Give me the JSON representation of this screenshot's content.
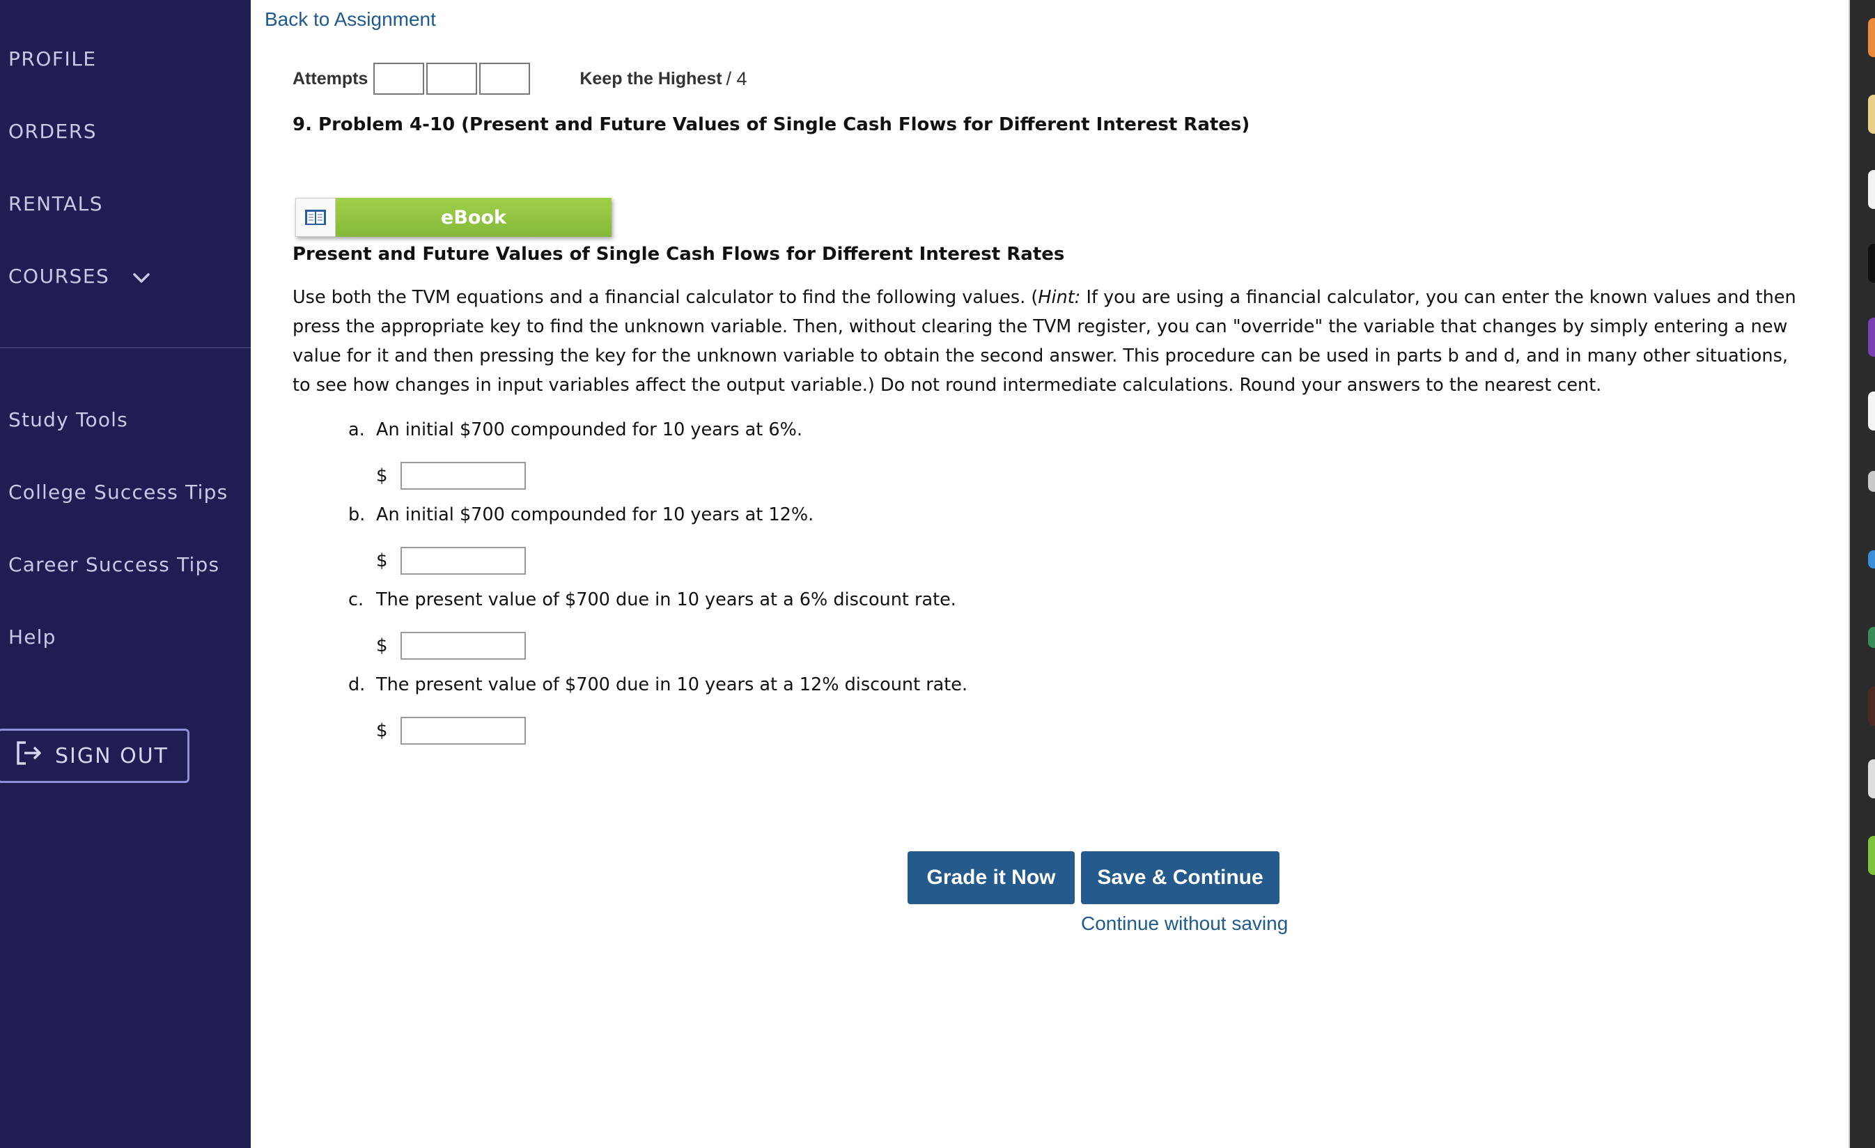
{
  "sidebar": {
    "nav": [
      "PROFILE",
      "ORDERS",
      "RENTALS",
      "COURSES"
    ],
    "tools": [
      "Study Tools",
      "College Success Tips",
      "Career Success Tips",
      "Help"
    ],
    "sign_out": "SIGN OUT"
  },
  "header": {
    "back_link": "Back to Assignment",
    "attempts_label": "Attempts",
    "keep_label": "Keep the Highest",
    "keep_score": "/ 4"
  },
  "problem": {
    "title": "9.  Problem 4-10 (Present and Future Values of Single Cash Flows for Different Interest Rates)",
    "ebook_label": "eBook",
    "subtitle": "Present and Future Values of Single Cash Flows for Different Interest Rates",
    "instructions_pre": "Use both the TVM equations and a financial calculator to find the following values. (",
    "instructions_hint": "Hint:",
    "instructions_post": " If you are using a financial calculator, you can enter the known values and then press the appropriate key to find the unknown variable. Then, without clearing the TVM register, you can \"override\" the variable that changes by simply entering a new value for it and then pressing the key for the unknown variable to obtain the second answer. This procedure can be used in parts b and d, and in many other situations, to see how changes in input variables affect the output variable.) Do not round intermediate calculations. Round your answers to the nearest cent.",
    "questions": [
      {
        "letter": "a.",
        "text": "An initial $700 compounded for 10 years at 6%.",
        "currency": "$",
        "value": ""
      },
      {
        "letter": "b.",
        "text": "An initial $700 compounded for 10 years at 12%.",
        "currency": "$",
        "value": ""
      },
      {
        "letter": "c.",
        "text": "The present value of $700 due in 10 years at a 6% discount rate.",
        "currency": "$",
        "value": ""
      },
      {
        "letter": "d.",
        "text": "The present value of $700 due in 10 years at a 12% discount rate.",
        "currency": "$",
        "value": ""
      }
    ]
  },
  "actions": {
    "grade": "Grade it Now",
    "save": "Save & Continue",
    "continue": "Continue without saving"
  },
  "colors": {
    "sidebar_bg": "#1f1d52",
    "link": "#1f5a8f",
    "button": "#245a8c",
    "ebook_green": "#8fc43f"
  }
}
